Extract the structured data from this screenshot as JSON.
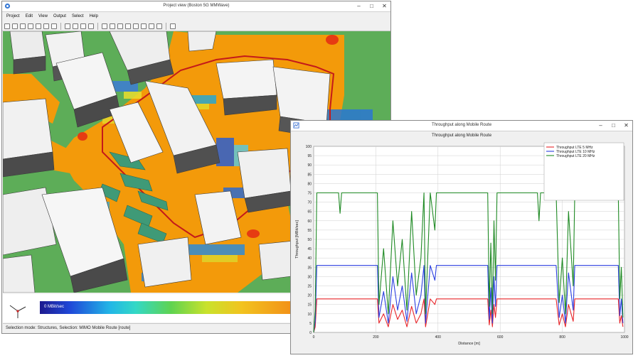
{
  "main_window": {
    "title": "Project view (Boston 5G MMWave)",
    "menu": [
      "Project",
      "Edit",
      "View",
      "Output",
      "Select",
      "Help"
    ],
    "window_buttons": [
      "–",
      "□",
      "✕"
    ],
    "colorbar_min_label": "0 MBit/sec",
    "status": "Selection mode: Structures,  Selection: MIMO Mobile Route [route]"
  },
  "chart_window": {
    "title": "Throughput along Mobile Route",
    "window_buttons": [
      "–",
      "□",
      "✕"
    ]
  },
  "chart_data": {
    "type": "line",
    "title": "Throughput along Mobile Route",
    "xlabel": "Distance [m]",
    "ylabel": "Throughput [MBit/sec]",
    "xlim": [
      0,
      1000
    ],
    "ylim": [
      0,
      100
    ],
    "xticks": [
      0,
      200,
      400,
      600,
      800,
      1000
    ],
    "yticks": [
      0,
      5,
      10,
      15,
      20,
      25,
      30,
      35,
      40,
      45,
      50,
      55,
      60,
      65,
      70,
      75,
      80,
      85,
      90,
      95,
      100
    ],
    "grid": true,
    "legend_position": "top-right",
    "series": [
      {
        "name": "Throughput LTE 5 MHz",
        "color": "#e8262a",
        "x": [
          0,
          5,
          10,
          205,
          210,
          225,
          240,
          255,
          270,
          285,
          300,
          315,
          330,
          345,
          355,
          360,
          375,
          390,
          395,
          560,
          565,
          570,
          575,
          580,
          585,
          590,
          600,
          780,
          790,
          800,
          810,
          820,
          835,
          840,
          845,
          980,
          985,
          990,
          995
        ],
        "y": [
          0,
          3,
          18,
          18,
          5,
          10,
          3,
          15,
          7,
          12,
          3,
          14,
          5,
          10,
          18,
          3,
          18,
          15,
          18,
          18,
          4,
          12,
          3,
          15,
          8,
          18,
          18,
          18,
          4,
          10,
          3,
          15,
          6,
          18,
          18,
          18,
          5,
          9,
          3
        ]
      },
      {
        "name": "Throughput LTE 10 MHz",
        "color": "#2b3fe0",
        "x": [
          0,
          5,
          10,
          205,
          210,
          225,
          240,
          255,
          270,
          285,
          300,
          315,
          330,
          345,
          355,
          360,
          375,
          390,
          395,
          560,
          565,
          570,
          575,
          580,
          585,
          590,
          600,
          780,
          790,
          800,
          810,
          820,
          835,
          840,
          845,
          980,
          985,
          990,
          995
        ],
        "y": [
          0,
          6,
          36,
          36,
          8,
          22,
          5,
          30,
          12,
          25,
          6,
          32,
          10,
          20,
          36,
          5,
          36,
          28,
          36,
          36,
          7,
          24,
          5,
          30,
          14,
          36,
          36,
          36,
          8,
          20,
          5,
          32,
          12,
          36,
          36,
          36,
          9,
          18,
          5
        ]
      },
      {
        "name": "Throughput LTE 20 MHz",
        "color": "#1f8a24",
        "x": [
          0,
          5,
          10,
          80,
          85,
          90,
          95,
          205,
          210,
          225,
          240,
          255,
          270,
          285,
          300,
          315,
          330,
          345,
          355,
          360,
          375,
          390,
          395,
          560,
          565,
          570,
          575,
          580,
          585,
          590,
          600,
          720,
          725,
          730,
          780,
          790,
          800,
          810,
          820,
          835,
          840,
          845,
          980,
          985,
          990,
          995
        ],
        "y": [
          0,
          12,
          75,
          75,
          64,
          75,
          75,
          75,
          15,
          45,
          10,
          60,
          25,
          50,
          12,
          65,
          20,
          40,
          75,
          10,
          75,
          55,
          75,
          75,
          14,
          48,
          10,
          60,
          28,
          75,
          75,
          75,
          60,
          75,
          75,
          16,
          40,
          10,
          65,
          25,
          75,
          75,
          75,
          18,
          35,
          8
        ]
      }
    ]
  }
}
